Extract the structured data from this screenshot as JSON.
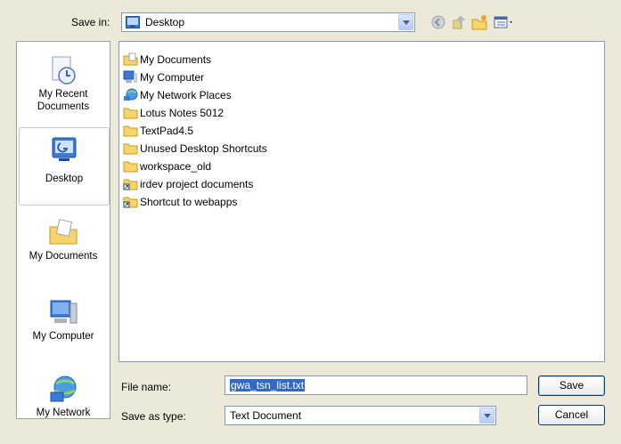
{
  "top": {
    "save_in_label": "Save in:",
    "location": "Desktop"
  },
  "places": [
    {
      "label": "My Recent Documents",
      "icon": "recent-documents-icon"
    },
    {
      "label": "Desktop",
      "icon": "desktop-icon",
      "selected": true
    },
    {
      "label": "My Documents",
      "icon": "my-documents-icon"
    },
    {
      "label": "My Computer",
      "icon": "my-computer-icon"
    },
    {
      "label": "My Network",
      "icon": "my-network-icon"
    }
  ],
  "files": [
    {
      "name": "My Documents",
      "icon": "documents-folder-icon"
    },
    {
      "name": "My Computer",
      "icon": "computer-icon"
    },
    {
      "name": "My Network Places",
      "icon": "network-places-icon"
    },
    {
      "name": "Lotus Notes 5012",
      "icon": "folder-icon"
    },
    {
      "name": "TextPad4.5",
      "icon": "folder-icon"
    },
    {
      "name": "Unused Desktop Shortcuts",
      "icon": "folder-icon"
    },
    {
      "name": "workspace_old",
      "icon": "folder-icon"
    },
    {
      "name": "irdev project documents",
      "icon": "shortcut-folder-icon"
    },
    {
      "name": "Shortcut to webapps",
      "icon": "shortcut-folder-icon"
    }
  ],
  "bottom": {
    "file_name_label": "File name:",
    "file_name_value": "gwa_tsn_list.txt",
    "save_as_type_label": "Save as type:",
    "save_as_type_value": "Text Document",
    "save_button": "Save",
    "cancel_button": "Cancel"
  },
  "colors": {
    "dialog_bg": "#ece9d8",
    "selection": "#316ac5",
    "border": "#7f9db9",
    "folder": "#f5d46b"
  }
}
